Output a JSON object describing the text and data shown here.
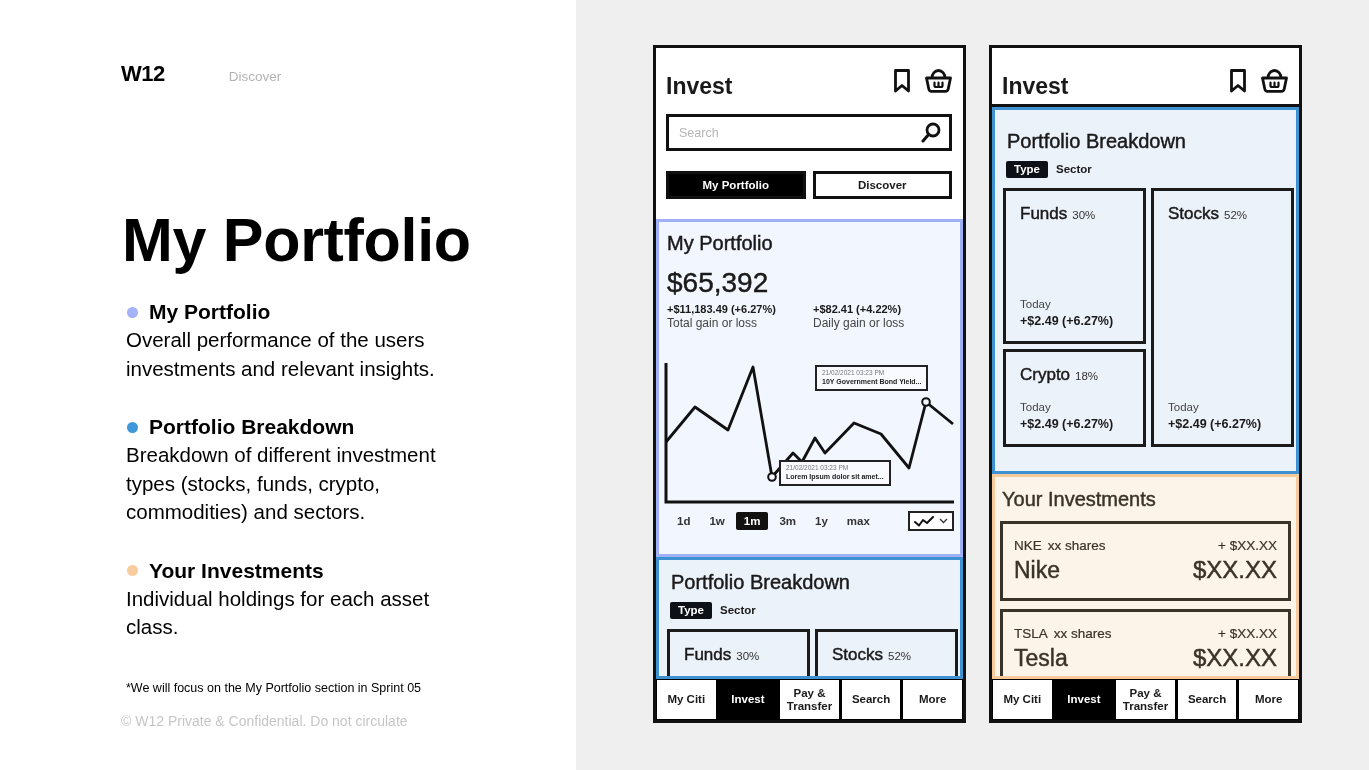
{
  "slide": {
    "logo": "W12",
    "nav_link": "Discover",
    "title": "My Portfolio",
    "sections": [
      {
        "title": "My Portfolio",
        "description": "Overall performance of the users investments and relevant insights.",
        "color": "#a4b2f7"
      },
      {
        "title": "Portfolio Breakdown",
        "description": "Breakdown of different investment types (stocks, funds, crypto, commodities) and sectors.",
        "color": "#3e97d9"
      },
      {
        "title": "Your Investments",
        "description": "Individual holdings for each asset class.",
        "color": "#f8cc9f"
      }
    ],
    "footnote": "*We will focus on the My Portfolio section in Sprint 05",
    "copyright": "© W12 Private & Confidential. Do not circulate"
  },
  "phones": [
    {
      "title": "Invest",
      "search": {
        "placeholder": "Search"
      },
      "tabs": [
        {
          "label": "My Portfolio",
          "selected": true
        },
        {
          "label": "Discover",
          "selected": false
        }
      ],
      "sections": [
        {
          "kind": "portfolio",
          "title": "My Portfolio",
          "total": "$65,392",
          "gains": [
            {
              "value": "+$11,183.49 (+6.27%)",
              "label": "Total gain or loss"
            },
            {
              "value": "+$82.41 (+4.22%)",
              "label": "Daily gain or loss"
            }
          ],
          "tooltips": [
            {
              "date": "21/02/2021 03:23 PM",
              "text": "10Y Government Bond Yield..."
            },
            {
              "date": "21/02/2021 03:23 PM",
              "text": "Lorem Ipsum dolor sit amet..."
            }
          ],
          "ranges": [
            {
              "label": "1d",
              "selected": false
            },
            {
              "label": "1w",
              "selected": false
            },
            {
              "label": "1m",
              "selected": true
            },
            {
              "label": "3m",
              "selected": false
            },
            {
              "label": "1y",
              "selected": false
            },
            {
              "label": "max",
              "selected": false
            }
          ]
        },
        {
          "kind": "breakdown",
          "title": "Portfolio Breakdown",
          "filters": [
            {
              "label": "Type",
              "selected": true
            },
            {
              "label": "Sector",
              "selected": false
            }
          ],
          "cards": [
            {
              "name": "Funds",
              "share": "30%"
            },
            {
              "name": "Stocks",
              "share": "52%"
            }
          ]
        }
      ],
      "nav": [
        {
          "label": "My Citi",
          "selected": false
        },
        {
          "label": "Invest",
          "selected": true
        },
        {
          "label": "Pay & Transfer",
          "selected": false
        },
        {
          "label": "Search",
          "selected": false
        },
        {
          "label": "More",
          "selected": false
        }
      ]
    },
    {
      "title": "Invest",
      "sections": [
        {
          "kind": "breakdown",
          "title": "Portfolio Breakdown",
          "filters": [
            {
              "label": "Type",
              "selected": true
            },
            {
              "label": "Sector",
              "selected": false
            }
          ],
          "cards": [
            {
              "name": "Funds",
              "share": "30%",
              "today_label": "Today",
              "today": "+$2.49 (+6.27%)"
            },
            {
              "name": "Crypto",
              "share": "18%",
              "today_label": "Today",
              "today": "+$2.49 (+6.27%)"
            },
            {
              "name": "Stocks",
              "share": "52%",
              "today_label": "Today",
              "today": "+$2.49 (+6.27%)"
            }
          ]
        },
        {
          "kind": "investments",
          "title": "Your Investments",
          "holdings": [
            {
              "ticker": "NKE",
              "shares": "xx shares",
              "change": "+ $XX.XX",
              "name": "Nike",
              "value": "$XX.XX"
            },
            {
              "ticker": "TSLA",
              "shares": "xx shares",
              "change": "+ $XX.XX",
              "name": "Tesla",
              "value": "$XX.XX"
            }
          ]
        }
      ],
      "nav": [
        {
          "label": "My Citi",
          "selected": false
        },
        {
          "label": "Invest",
          "selected": true
        },
        {
          "label": "Pay & Transfer",
          "selected": false
        },
        {
          "label": "Search",
          "selected": false
        },
        {
          "label": "More",
          "selected": false
        }
      ]
    }
  ]
}
